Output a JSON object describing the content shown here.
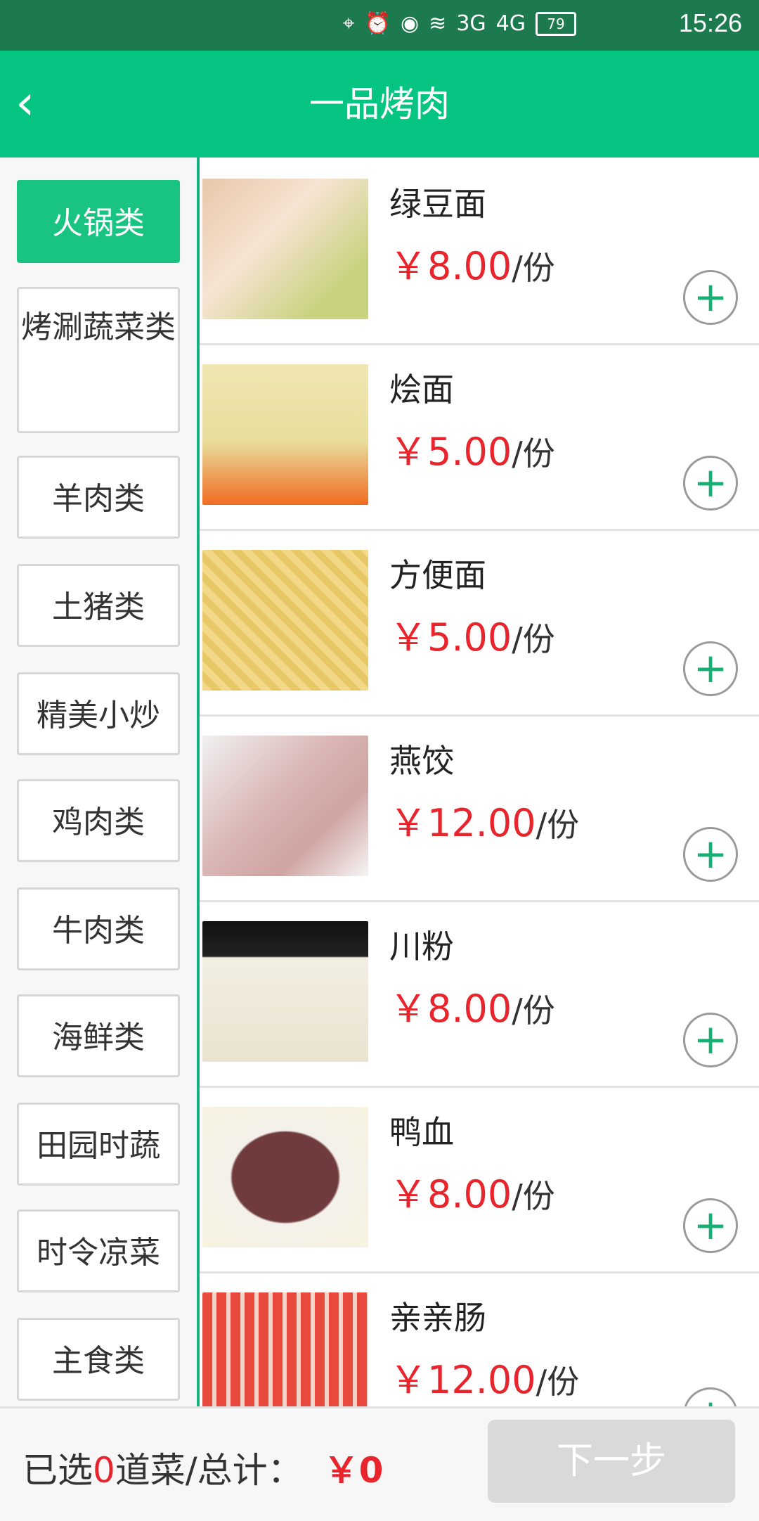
{
  "status_bar": {
    "time": "15:26",
    "battery": "79",
    "network": [
      "3G",
      "4G"
    ],
    "icons": [
      "location-icon",
      "alarm-icon",
      "eye-icon",
      "wifi-icon",
      "signal-icon",
      "battery-icon"
    ]
  },
  "header": {
    "title": "一品烤肉",
    "back_icon": "‹"
  },
  "categories": [
    {
      "label": "火锅类",
      "active": true
    },
    {
      "label": "烤涮蔬菜类"
    },
    {
      "label": "羊肉类"
    },
    {
      "label": "土猪类"
    },
    {
      "label": "精美小炒"
    },
    {
      "label": "鸡肉类"
    },
    {
      "label": "牛肉类"
    },
    {
      "label": "海鲜类"
    },
    {
      "label": "田园时蔬"
    },
    {
      "label": "时令凉菜"
    },
    {
      "label": "主食类"
    }
  ],
  "items": [
    {
      "name": "绿豆面",
      "price": "￥8.00",
      "unit": "/份"
    },
    {
      "name": "烩面",
      "price": "￥5.00",
      "unit": "/份"
    },
    {
      "name": "方便面",
      "price": "￥5.00",
      "unit": "/份"
    },
    {
      "name": "燕饺",
      "price": "￥12.00",
      "unit": "/份"
    },
    {
      "name": "川粉",
      "price": "￥8.00",
      "unit": "/份"
    },
    {
      "name": "鸭血",
      "price": "￥8.00",
      "unit": "/份"
    },
    {
      "name": "亲亲肠",
      "price": "￥12.00",
      "unit": "/份"
    }
  ],
  "footer": {
    "selected_prefix": "已选",
    "selected_count": "0",
    "selected_suffix": "道菜/总计：",
    "total": "￥0",
    "next_label": "下一步"
  },
  "colors": {
    "accent": "#06c582",
    "price": "#e8252d",
    "status_bar": "#1d7a4e"
  }
}
